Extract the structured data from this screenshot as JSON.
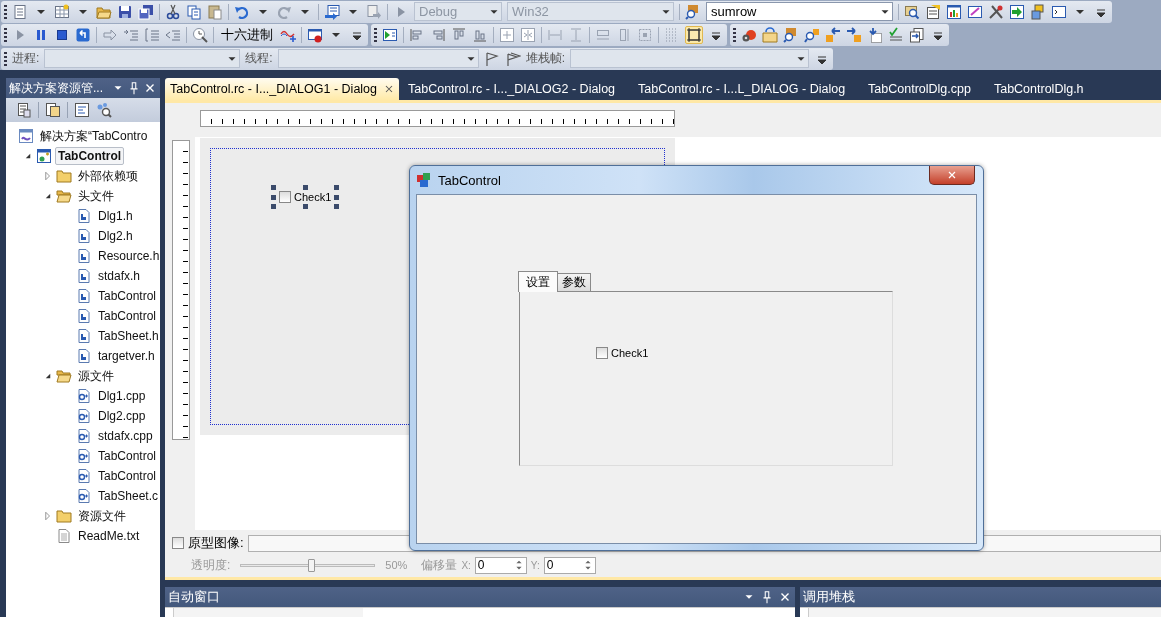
{
  "toolbar": {
    "config": "Debug",
    "platform": "Win32",
    "find": "sumrow",
    "hex_button": "十六进制",
    "process_label": "进程:",
    "thread_label": "线程:",
    "stack_frame_label": "堆栈帧:"
  },
  "solution_explorer": {
    "title": "解决方案资源管...",
    "tree": [
      {
        "label": "解决方案“TabContro",
        "kind": "solution",
        "selected": false,
        "children": [
          {
            "label": "TabControl",
            "kind": "project",
            "selected": true,
            "expanded": true,
            "children": [
              {
                "label": "外部依赖项",
                "kind": "folder",
                "selected": false,
                "expanded": false
              },
              {
                "label": "头文件",
                "kind": "folder",
                "selected": false,
                "expanded": true,
                "children": [
                  {
                    "label": "Dlg1.h",
                    "kind": "header",
                    "selected": false
                  },
                  {
                    "label": "Dlg2.h",
                    "kind": "header",
                    "selected": false
                  },
                  {
                    "label": "Resource.h",
                    "kind": "header",
                    "selected": false
                  },
                  {
                    "label": "stdafx.h",
                    "kind": "header",
                    "selected": false
                  },
                  {
                    "label": "TabControl",
                    "kind": "header",
                    "selected": false
                  },
                  {
                    "label": "TabControl",
                    "kind": "header",
                    "selected": false
                  },
                  {
                    "label": "TabSheet.h",
                    "kind": "header",
                    "selected": false
                  },
                  {
                    "label": "targetver.h",
                    "kind": "header",
                    "selected": false
                  }
                ]
              },
              {
                "label": "源文件",
                "kind": "folder",
                "selected": false,
                "expanded": true,
                "children": [
                  {
                    "label": "Dlg1.cpp",
                    "kind": "source",
                    "selected": false
                  },
                  {
                    "label": "Dlg2.cpp",
                    "kind": "source",
                    "selected": false
                  },
                  {
                    "label": "stdafx.cpp",
                    "kind": "source",
                    "selected": false
                  },
                  {
                    "label": "TabControl",
                    "kind": "source",
                    "selected": false
                  },
                  {
                    "label": "TabControl",
                    "kind": "source",
                    "selected": false
                  },
                  {
                    "label": "TabSheet.c",
                    "kind": "source",
                    "selected": false
                  }
                ]
              },
              {
                "label": "资源文件",
                "kind": "folder",
                "selected": false,
                "expanded": false
              },
              {
                "label": "ReadMe.txt",
                "kind": "text",
                "selected": false
              }
            ]
          }
        ]
      }
    ]
  },
  "editor_tabs": [
    {
      "label": "TabControl.rc - I..._DIALOG1 - Dialog",
      "selected": true
    },
    {
      "label": "TabControl.rc - I..._DIALOG2 - Dialog",
      "selected": false
    },
    {
      "label": "TabControl.rc - I...L_DIALOG - Dialog",
      "selected": false
    },
    {
      "label": "TabControlDlg.cpp",
      "selected": false
    },
    {
      "label": "TabControlDlg.h",
      "selected": false
    }
  ],
  "designer": {
    "checkbox_label": "Check1",
    "checked": false
  },
  "prototype": {
    "label": "原型图像:",
    "checked": false,
    "opacity_label": "透明度:",
    "level": 0.52,
    "reading": "50%",
    "offset_label": "偏移量",
    "x_label": "X:",
    "x_value": "0",
    "y_label": "Y:",
    "y_value": "0"
  },
  "dialog": {
    "title": "TabControl",
    "tabs": [
      {
        "label": "设置",
        "selected": true
      },
      {
        "label": "参数",
        "selected": false
      }
    ],
    "checkbox_label": "Check1",
    "checked": false
  },
  "bottom_panels": [
    {
      "title": "自动窗口"
    },
    {
      "title": "调用堆栈"
    }
  ]
}
